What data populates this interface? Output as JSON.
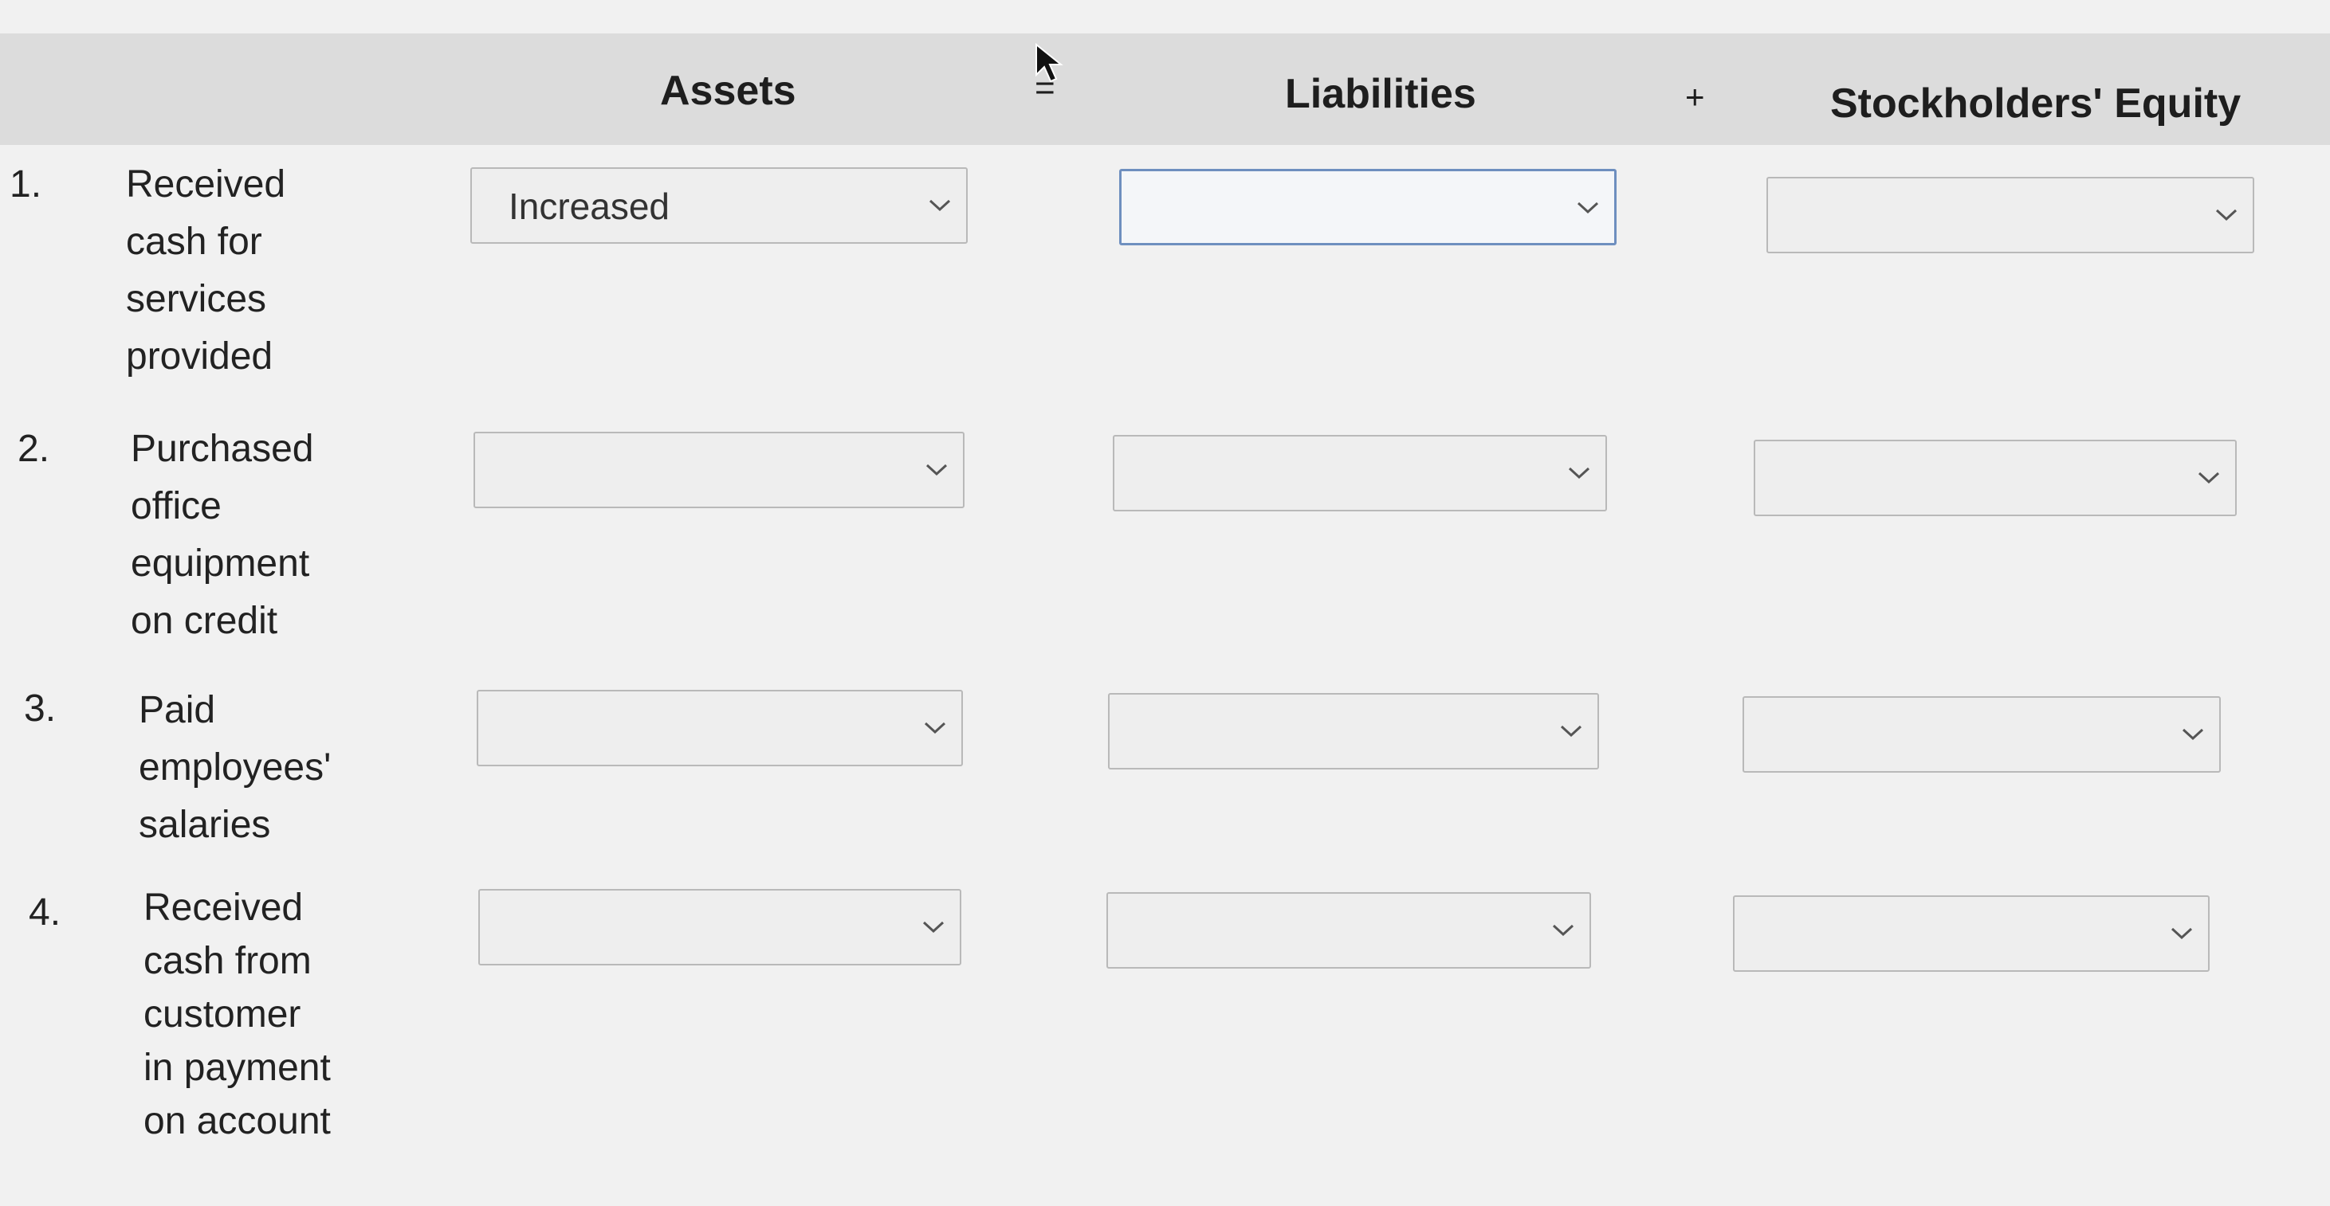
{
  "header": {
    "assets": "Assets",
    "equals": "=",
    "liabilities": "Liabilities",
    "plus": "+",
    "equity": "Stockholders' Equity"
  },
  "rows": [
    {
      "number": "1.",
      "description": "Received\ncash for\nservices\nprovided",
      "assets": "Increased",
      "liabilities": "",
      "equity": ""
    },
    {
      "number": "2.",
      "description": "Purchased\noffice\nequipment\non credit",
      "assets": "",
      "liabilities": "",
      "equity": ""
    },
    {
      "number": "3.",
      "description": "Paid\nemployees'\nsalaries",
      "assets": "",
      "liabilities": "",
      "equity": ""
    },
    {
      "number": "4.",
      "description": "Received\ncash from\ncustomer\nin payment\non account",
      "assets": "",
      "liabilities": "",
      "equity": ""
    }
  ],
  "icons": {
    "dropdown": "chevron-down-icon",
    "cursor": "mouse-pointer-icon"
  }
}
